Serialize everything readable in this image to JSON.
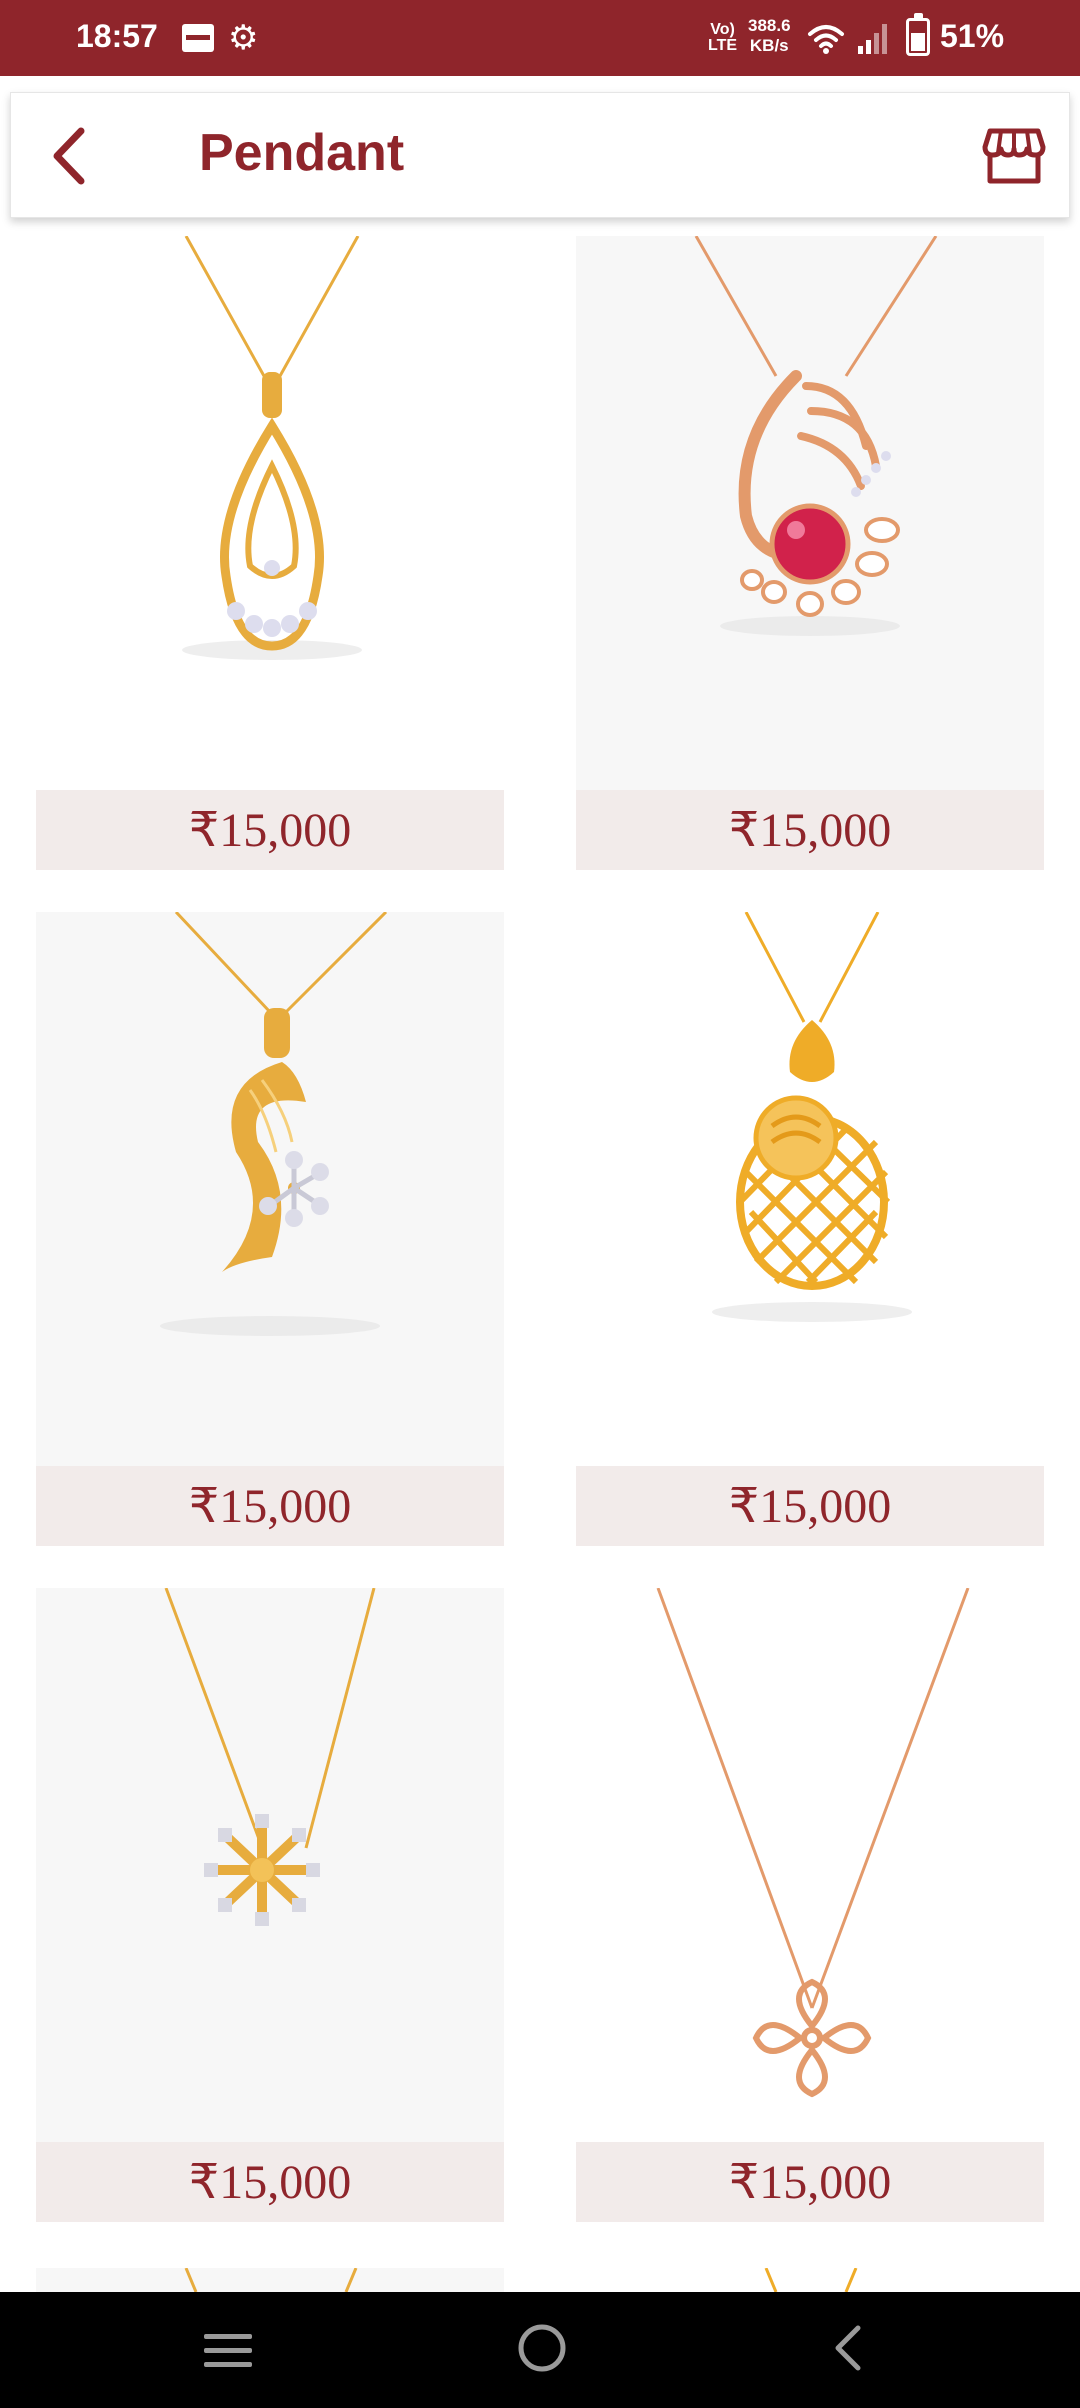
{
  "status_bar": {
    "time": "18:57",
    "volte_top": "Vo)",
    "volte_bottom": "LTE",
    "speed_value": "388.6",
    "speed_unit": "KB/s",
    "battery": "51%"
  },
  "header": {
    "title": "Pendant",
    "back_icon": "chevron-left-icon",
    "store_icon": "store-icon"
  },
  "products": [
    {
      "price": "₹15,000",
      "background": "white",
      "metal": "#e7ac3e"
    },
    {
      "price": "₹15,000",
      "background": "grey",
      "metal": "#e39a6b"
    },
    {
      "price": "₹15,000",
      "background": "grey",
      "metal": "#e7ac3e"
    },
    {
      "price": "₹15,000",
      "background": "white",
      "metal": "#efac28"
    },
    {
      "price": "₹15,000",
      "background": "grey",
      "metal": "#e7ac3e"
    },
    {
      "price": "₹15,000",
      "background": "white",
      "metal": "#e39a6b"
    }
  ],
  "colors": {
    "brand": "#8f252b",
    "price_bg": "#f2ebea",
    "image_bg": "#f7f7f7"
  },
  "nav_bar": {
    "menu_icon": "menu-icon",
    "home_icon": "home-circle-icon",
    "back_icon": "back-triangle-icon"
  }
}
